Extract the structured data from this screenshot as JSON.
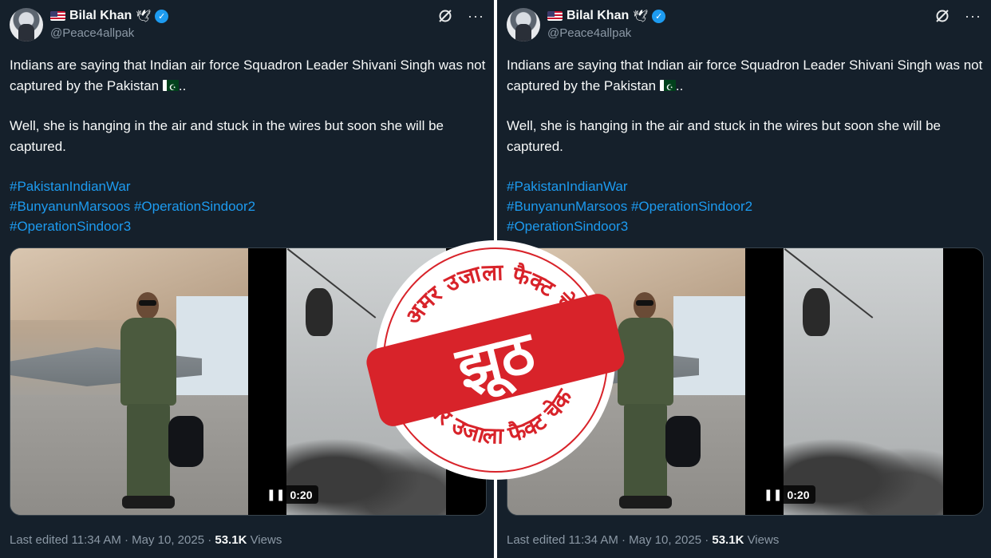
{
  "tweet": {
    "display_name": "Bilal Khan",
    "handle": "@Peace4allpak",
    "emblem": "🕊",
    "verified_mark": "✓",
    "paragraph1_a": "Indians are saying that Indian air force Squadron Leader Shivani Singh was not captured by the Pakistan ",
    "paragraph1_b": "..",
    "paragraph2": "Well, she is hanging in the air and stuck in the wires but soon she will be captured.",
    "hashtags": [
      "#PakistanIndianWar",
      "#BunyanunMarsoos",
      "#OperationSindoor2",
      "#OperationSindoor3"
    ],
    "video_duration": "0:20",
    "footer_prefix": "Last edited 11:34 AM · May 10, 2025 · ",
    "views_count": "53.1K",
    "views_label": " Views",
    "icons": [
      "grok-icon",
      "more-icon",
      "us-flag-icon",
      "verified-icon",
      "pakistan-flag-icon",
      "pause-icon"
    ]
  },
  "stamp": {
    "ring_text_top": "अमर उजाला फैक्ट चेक",
    "ring_text_bottom": "अमर उजाला फैक्ट चेक",
    "label": "झूठ",
    "colors": {
      "red": "#d8232a",
      "white": "#ffffff"
    }
  },
  "colors": {
    "background": "#15202b",
    "link": "#1d9bf0",
    "muted": "#8b98a5"
  }
}
